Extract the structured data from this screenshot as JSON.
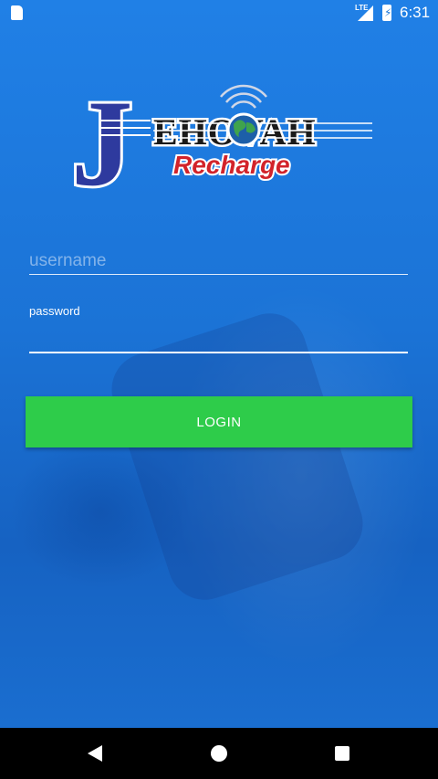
{
  "status_bar": {
    "network_label": "LTE",
    "time": "6:31"
  },
  "logo": {
    "brand_big_letter": "J",
    "brand_word": "EHOVAH",
    "tagline": "Recharge"
  },
  "login_form": {
    "username_placeholder": "username",
    "password_label": "password",
    "login_button_label": "LOGIN"
  },
  "colors": {
    "background": "#1f78d8",
    "button": "#2ecc4a",
    "logo_blue": "#2e3a9e",
    "logo_red": "#d2232a"
  },
  "icons": {
    "status": [
      "sim-card-icon",
      "signal-icon",
      "battery-charging-icon"
    ],
    "navigation": [
      "back-icon",
      "home-icon",
      "recents-icon"
    ]
  }
}
